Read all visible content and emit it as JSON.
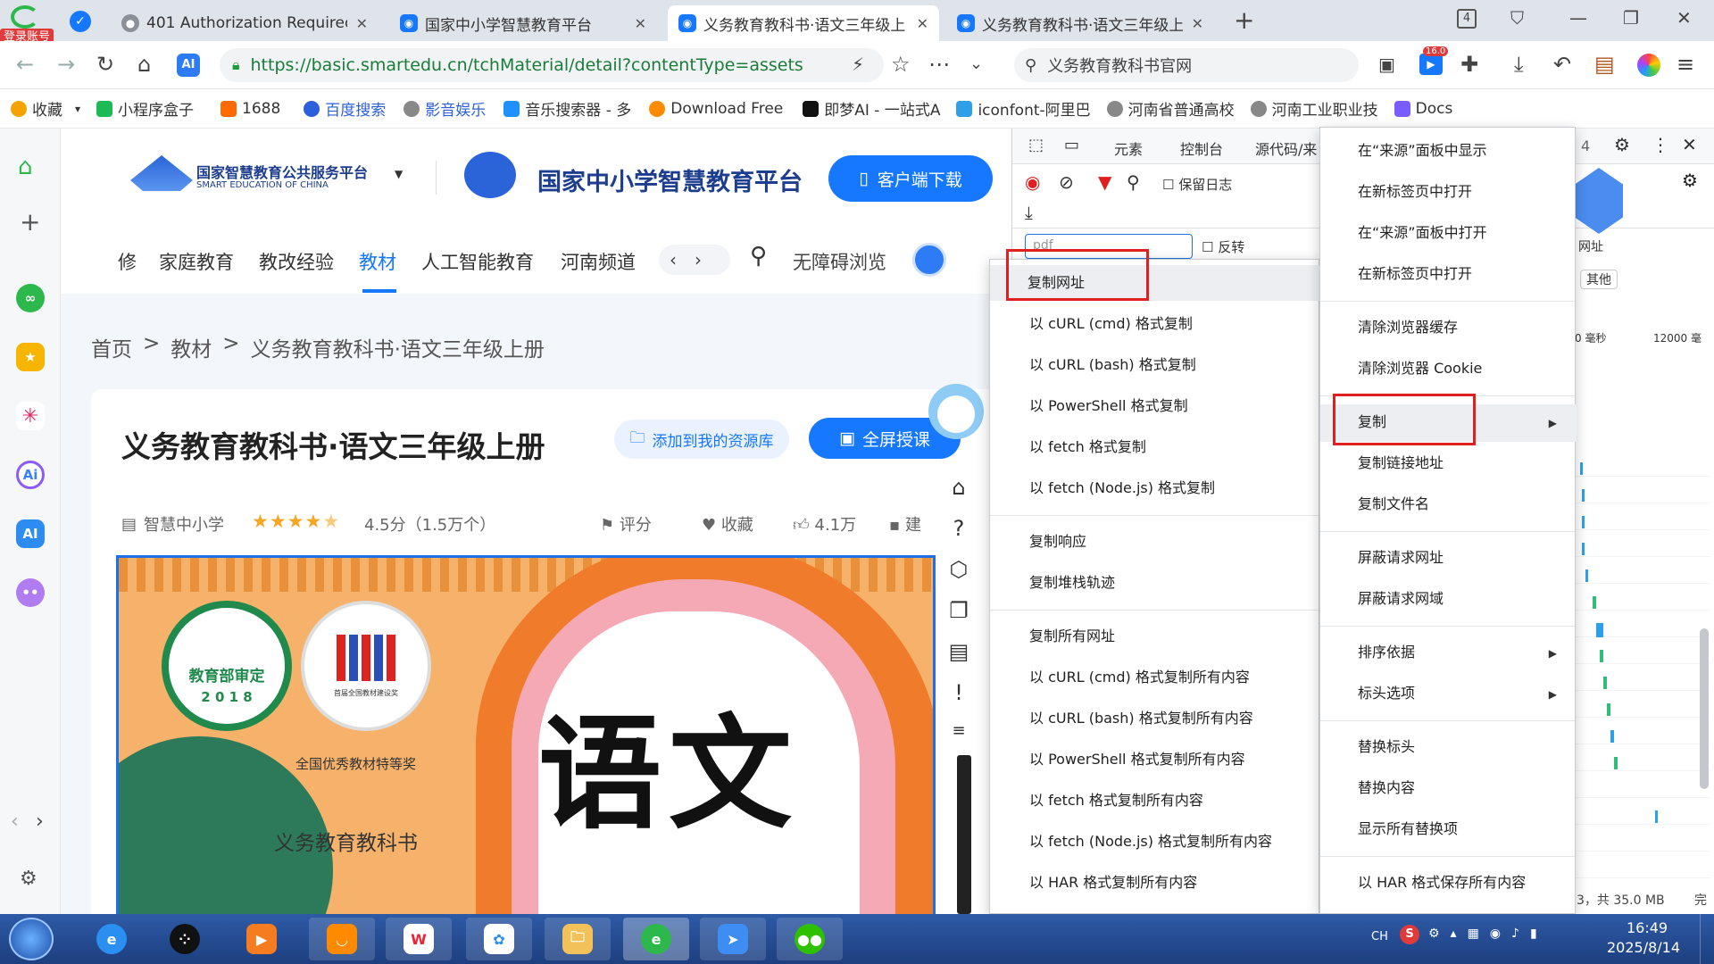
{
  "browser": {
    "login_badge": "登录账号",
    "tabs": [
      {
        "title": "401 Authorization Required",
        "active": false
      },
      {
        "title": "国家中小学智慧教育平台",
        "active": false
      },
      {
        "title": "义务教育教科书·语文三年级上",
        "active": true
      },
      {
        "title": "义务教育教科书·语文三年级上",
        "active": false
      }
    ],
    "new_tab_label": "+",
    "tab_count": "4",
    "url": "https://basic.smartedu.cn/tchMaterial/detail?contentType=assets",
    "search_text": "义务教育教科书官网",
    "download_badge": "16.0"
  },
  "bookmarks": [
    {
      "label": "收藏",
      "color": "#f4a300"
    },
    {
      "label": "小程序盒子",
      "color": "#1db954"
    },
    {
      "label": "1688",
      "color": "#ff6a00"
    },
    {
      "label": "百度搜索",
      "color": "#2b5fdc"
    },
    {
      "label": "影音娱乐",
      "color": "#888888"
    },
    {
      "label": "音乐搜索器 - 多",
      "color": "#1e90ff"
    },
    {
      "label": "Download Free",
      "color": "#ff8c00"
    },
    {
      "label": "即梦AI - 一站式A",
      "color": "#111111"
    },
    {
      "label": "iconfont-阿里巴",
      "color": "#2fa0e8"
    },
    {
      "label": "河南省普通高校",
      "color": "#888888"
    },
    {
      "label": "河南工业职业技",
      "color": "#888888"
    },
    {
      "label": "Docs",
      "color": "#7a5cff"
    }
  ],
  "site": {
    "platform_name": "国家智慧教育公共服务平台",
    "platform_name_en": "SMART EDUCATION OF CHINA",
    "main_title": "国家中小学智慧教育平台",
    "client_download": "客户端下载",
    "nav": [
      "修",
      "家庭教育",
      "教改经验",
      "教材",
      "人工智能教育",
      "河南频道"
    ],
    "nav_active": "教材",
    "accessibility": "无障碍浏览",
    "breadcrumb": [
      "首页",
      ">",
      "教材",
      ">",
      "义务教育教科书·语文三年级上册"
    ],
    "book_title": "义务教育教科书·语文三年级上册",
    "add_resource": "添加到我的资源库",
    "fullscreen": "全屏授课",
    "publisher": "智慧中小学",
    "rating_text": "4.5分（1.5万个）",
    "actions": [
      "评分",
      "收藏",
      "4.1万",
      "建"
    ],
    "cover": {
      "badge_top": "教育部审定",
      "badge_year": "2 0 1 8",
      "award_small": "首届全国教材建设奖",
      "award": "全国优秀教材特等奖",
      "series": "义务教育教科书",
      "subject": "语文"
    }
  },
  "devtools": {
    "tabs": [
      "元素",
      "控制台",
      "源代码/来"
    ],
    "preserve_log": "保留日志",
    "filter_value": "pdf",
    "invert": "反转",
    "count_badge": "4",
    "right_labels": [
      "网址",
      "其他",
      "0 毫秒",
      "12000 毫"
    ],
    "status": "3，共 35.0 MB",
    "status_tail": "完"
  },
  "copy_submenu": {
    "groups": [
      [
        "复制网址",
        "以 cURL (cmd) 格式复制",
        "以 cURL (bash) 格式复制",
        "以 PowerShell 格式复制",
        "以 fetch 格式复制",
        "以 fetch (Node.js) 格式复制"
      ],
      [
        "复制响应",
        "复制堆栈轨迹"
      ],
      [
        "复制所有网址",
        "以 cURL (cmd) 格式复制所有内容",
        "以 cURL (bash) 格式复制所有内容",
        "以 PowerShell 格式复制所有内容",
        "以 fetch 格式复制所有内容",
        "以 fetch (Node.js) 格式复制所有内容",
        "以 HAR 格式复制所有内容"
      ]
    ],
    "highlighted": "复制网址"
  },
  "context_menu": {
    "groups": [
      [
        "在“来源”面板中显示",
        "在新标签页中打开",
        "在“来源”面板中打开",
        "在新标签页中打开"
      ],
      [
        "清除浏览器缓存",
        "清除浏览器 Cookie"
      ],
      [
        "复制",
        "复制链接地址",
        "复制文件名"
      ],
      [
        "屏蔽请求网址",
        "屏蔽请求网域"
      ],
      [
        "排序依据",
        "标头选项"
      ],
      [
        "替换标头",
        "替换内容",
        "显示所有替换项"
      ],
      [
        "以 HAR 格式保存所有内容"
      ]
    ],
    "highlighted": "复制",
    "has_submenu": [
      "复制",
      "排序依据",
      "标头选项"
    ]
  },
  "taskbar": {
    "tray_lang": "CH",
    "time": "16:49",
    "date": "2025/8/14"
  }
}
